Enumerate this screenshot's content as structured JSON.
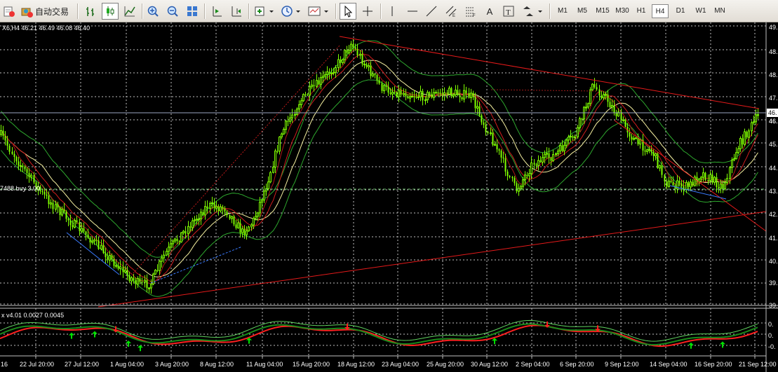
{
  "toolbar": {
    "autotrading_label": "自动交易",
    "timeframes": [
      "M1",
      "M5",
      "M15",
      "M30",
      "H1",
      "H4",
      "D1",
      "W1",
      "MN"
    ],
    "active_timeframe": "H4",
    "text_tool": "A"
  },
  "chart": {
    "header": "X6,H4  46.21 46.49 46.08 46.40",
    "order_label": "7488 buy 3.00",
    "indicator_header": "x v4.01  0.0027  0.0045",
    "price_labels": [
      "49.",
      "48.",
      "48.",
      "47.",
      "46.",
      "46.",
      "45.",
      "44.",
      "43.",
      "42.",
      "41.",
      "40.",
      "39.",
      "39."
    ],
    "current_price_label": "46.",
    "indicator_labels": [
      "0.",
      "0.",
      "-0."
    ],
    "time_labels": [
      "16",
      "22 Jul 20:00",
      "27 Jul 12:00",
      "1 Aug 04:00",
      "3 Aug 20:00",
      "8 Aug 12:00",
      "11 Aug 04:00",
      "15 Aug 20:00",
      "18 Aug 12:00",
      "23 Aug 04:00",
      "25 Aug 20:00",
      "30 Aug 12:00",
      "2 Sep 04:00",
      "6 Sep 20:00",
      "9 Sep 12:00",
      "14 Sep 04:00",
      "16 Sep 20:00",
      "21 Sep 12:00"
    ]
  },
  "colors": {
    "background": "#000000",
    "bull_candle": "#7fff00",
    "grid": "#c0c0c0",
    "trendline": "#e51a1a",
    "envelope": "#2ea82e",
    "ma_fast": "#d01e1e",
    "ma_slow": "#f5f0a0",
    "signal_up": "#00e000",
    "signal_down": "#ff2020"
  }
}
